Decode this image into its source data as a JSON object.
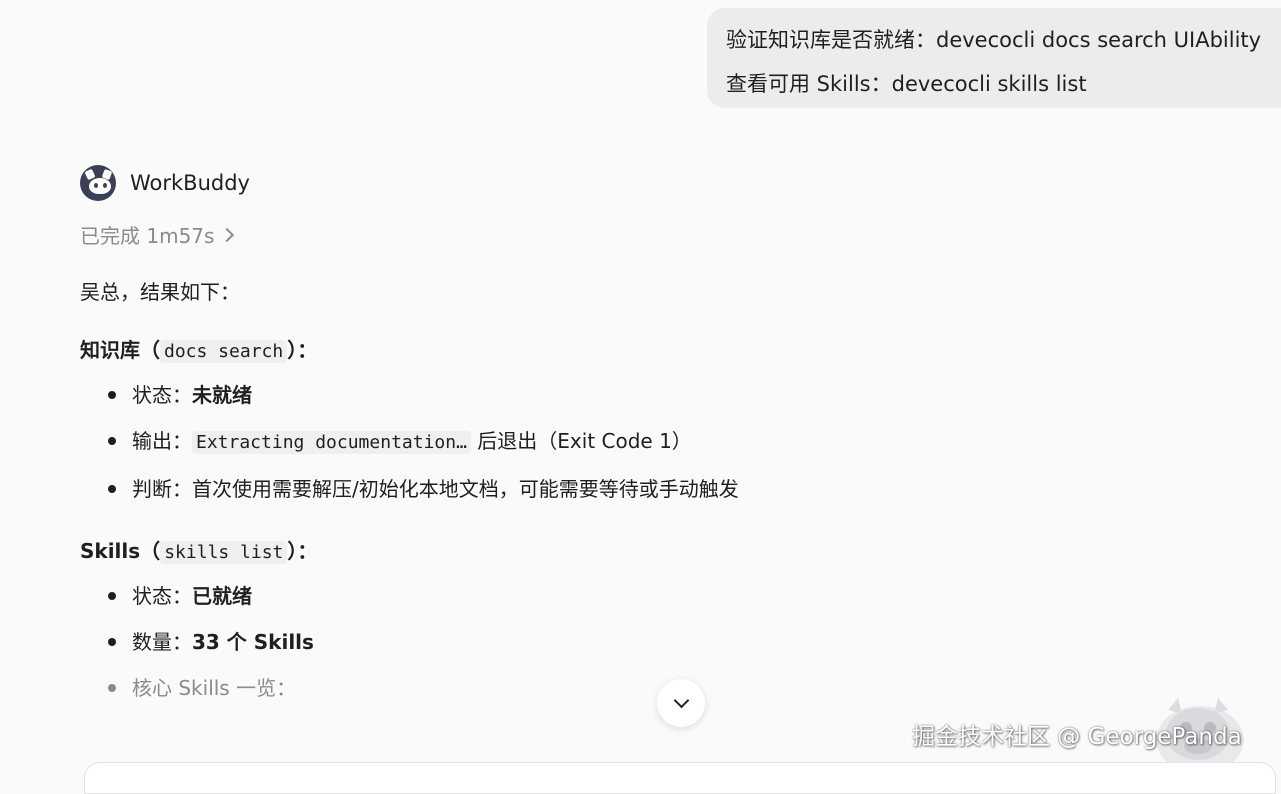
{
  "user_message": {
    "line1": "验证知识库是否就绪：devecocli docs search UIAbility",
    "line2": "查看可用 Skills：devecocli skills list"
  },
  "assistant": {
    "name": "WorkBuddy",
    "avatar_icon": "raccoon-avatar-icon",
    "status": "已完成 1m57s"
  },
  "reply": {
    "intro": "吴总，结果如下：",
    "section1": {
      "title": "知识库（",
      "code": "docs search",
      "title_end": "）：",
      "items": [
        {
          "label": "状态：",
          "value_bold": "未就绪"
        },
        {
          "label": "输出：",
          "code": "Extracting documentation…",
          "rest": " 后退出（Exit Code 1）"
        },
        {
          "label": "判断：",
          "text": "首次使用需要解压/初始化本地文档，可能需要等待或手动触发"
        }
      ]
    },
    "section2": {
      "title": "Skills（",
      "code": "skills list",
      "title_end": "）：",
      "items": [
        {
          "label": "状态：",
          "value_bold": "已就绪"
        },
        {
          "label": "数量：",
          "value_bold": "33 个 Skills"
        },
        {
          "label": "核心 Skills 一览："
        }
      ]
    }
  },
  "watermark": "掘金技术社区 @ GeorgePanda",
  "colors": {
    "background": "#fafafb",
    "user_bubble": "#ececed",
    "muted_text": "#8a8a8f",
    "avatar": "#3b3f57"
  }
}
